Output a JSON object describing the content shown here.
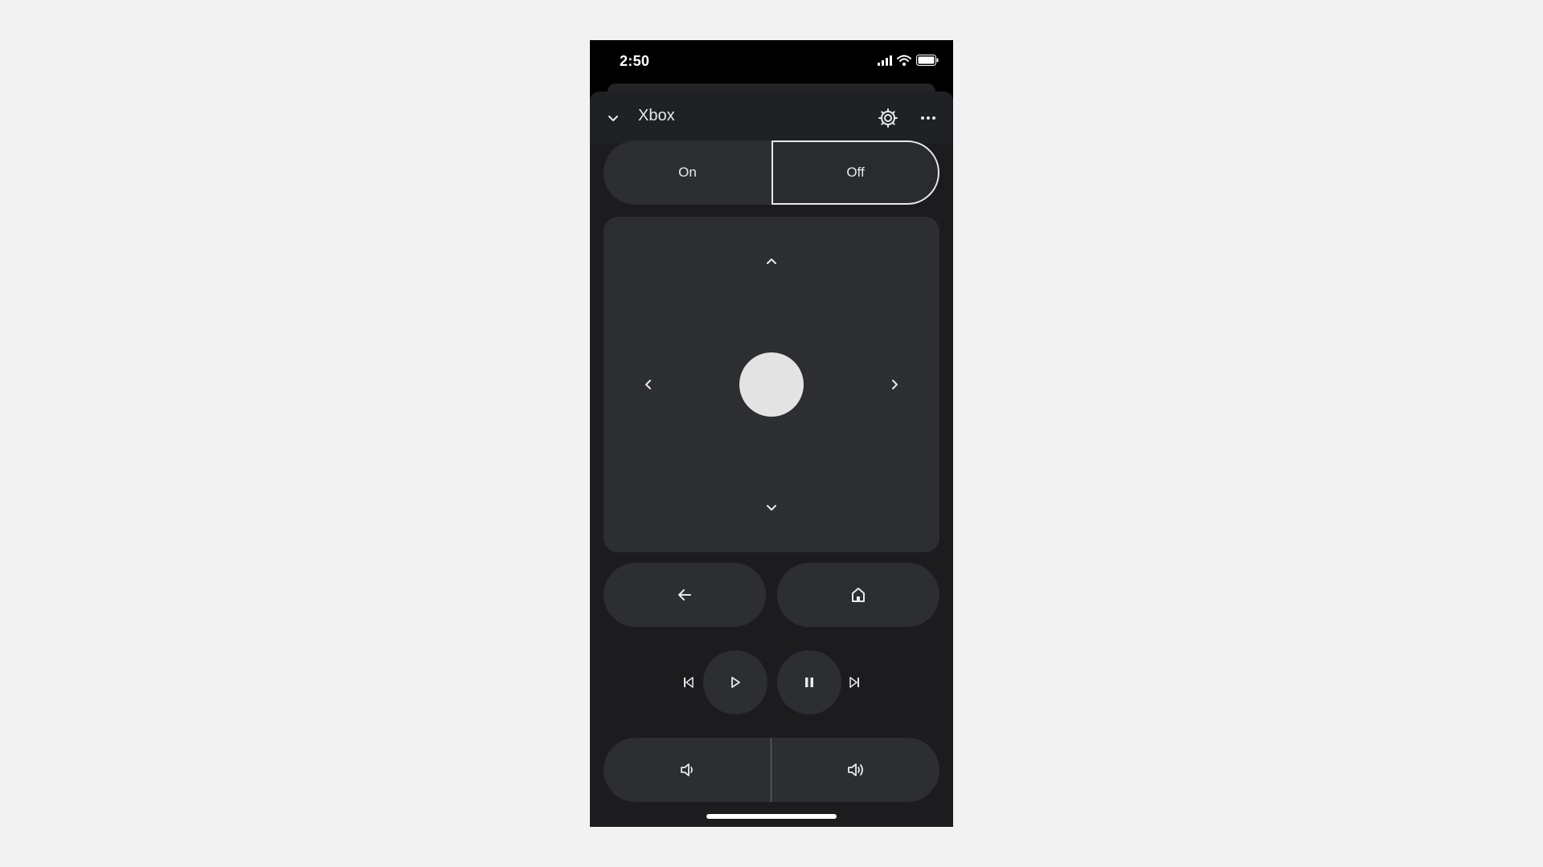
{
  "status_bar": {
    "time": "2:50",
    "icons": [
      "signal-icon",
      "wifi-icon",
      "battery-icon"
    ]
  },
  "header": {
    "title": "Xbox",
    "icons": [
      "chevron-down-icon",
      "gear-icon",
      "more-horizontal-icon"
    ]
  },
  "power": {
    "on_label": "On",
    "off_label": "Off",
    "selected": "Off"
  },
  "dpad": {
    "icons": [
      "chevron-up-icon",
      "chevron-down-icon",
      "chevron-left-icon",
      "chevron-right-icon",
      "ok-button"
    ]
  },
  "navigation": {
    "icons": [
      "arrow-back-icon",
      "home-icon"
    ]
  },
  "media": {
    "icons": [
      "skip-previous-icon",
      "play-icon",
      "pause-icon",
      "skip-next-icon"
    ]
  },
  "volume": {
    "icons": [
      "volume-down-icon",
      "volume-up-icon"
    ]
  },
  "colors": {
    "page_background": "#f2f2f2",
    "phone_background": "#000000",
    "sheet_background": "#1c1c1e",
    "control_background": "#2d2e31",
    "text": "#e8eaed",
    "ok_button": "#e3e3e3"
  }
}
